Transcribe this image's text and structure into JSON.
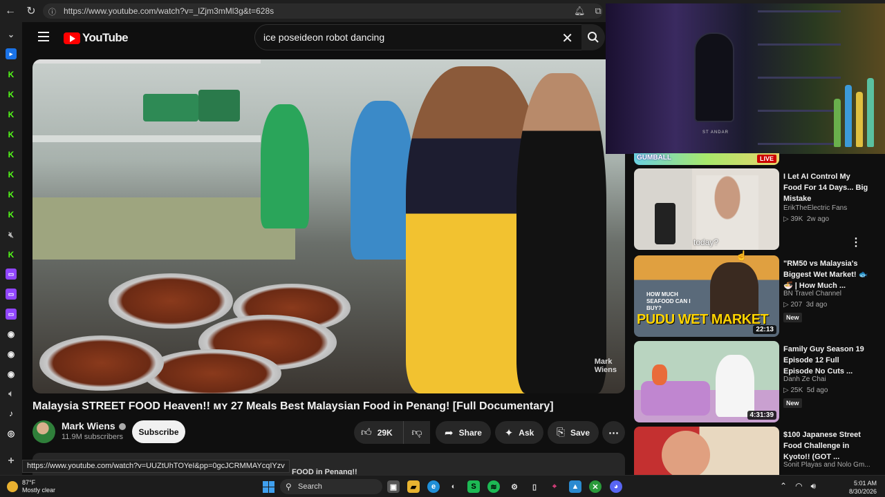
{
  "browser": {
    "url": "https://www.youtube.com/watch?v=_lZjm3mMl3g&t=628s",
    "hover_link": "https://www.youtube.com/watch?v=UUZtUhTOYeI&pp=0gcJCRMMAYcqIYzv"
  },
  "youtube": {
    "logo": "YouTube",
    "search_query": "ice poseideon robot dancing"
  },
  "video": {
    "watermark_line1": "Mark",
    "watermark_line2": "Wiens",
    "title": "Malaysia STREET FOOD Heaven!! ᴍʏ 27 Meals Best Malaysian Food in Penang! [Full Documentary]",
    "channel": "Mark Wiens",
    "subscribers": "11.9M subscribers",
    "subscribe_label": "Subscribe",
    "likes": "29K",
    "share_label": "Share",
    "ask_label": "Ask",
    "save_label": "Save",
    "description_peek": "FOOD in Penang!!"
  },
  "webcam": {
    "caption": "ST ANDAR"
  },
  "live_banner": {
    "text": "GUMBALL",
    "live_label": "LIVE"
  },
  "recommendations": [
    {
      "title": "I Let AI Control My Food For 14 Days... Big Mistake",
      "channel": "ErikTheElectric Fans",
      "views": "39K",
      "age": "2w ago",
      "duration": "",
      "is_new": false,
      "thumb_caption": "today?"
    },
    {
      "title": "\"RM50 vs Malaysia's Biggest Wet Market! 🐟🍜 | How Much ...",
      "channel": "BN Travel Channel",
      "views": "207",
      "age": "3d ago",
      "duration": "22:13",
      "is_new": true,
      "thumb_caption": "PUDU WET MARKET",
      "thumb_sub": "HOW MUCH SEAFOOD CAN I BUY?"
    },
    {
      "title": "Family Guy Season 19 Episode 12 Full Episode No Cuts ...",
      "channel": "Danh Ze Chai",
      "views": "25K",
      "age": "5d ago",
      "duration": "4:31:39",
      "is_new": true
    },
    {
      "title": "$100 Japanese Street Food Challenge in Kyoto!! (GOT ...",
      "channel": "Sonit Playas and Nolo Gm...",
      "views": "",
      "age": "",
      "duration": "",
      "is_new": false
    }
  ],
  "new_label": "New",
  "taskbar": {
    "temp": "87°F",
    "weather": "Mostly clear",
    "search": "Search",
    "time": "5:01 AM",
    "date": "8/30/2026"
  }
}
